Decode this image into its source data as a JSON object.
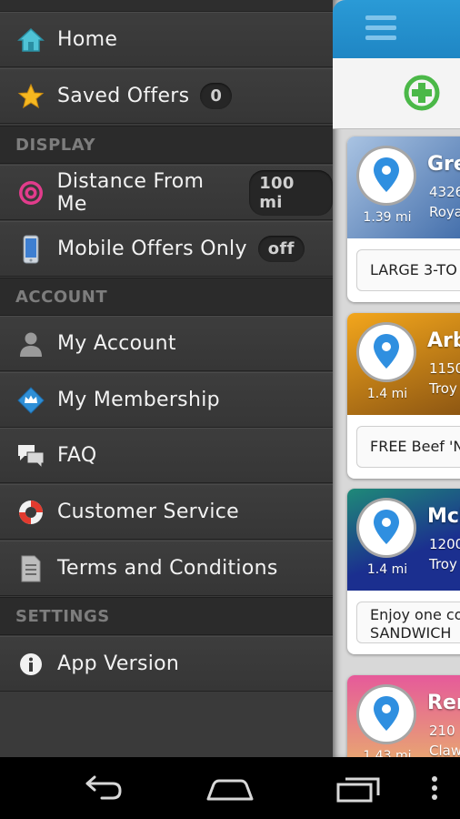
{
  "drawer": {
    "items_top": [
      {
        "label": "Home",
        "icon": "home-icon"
      },
      {
        "label": "Saved Offers",
        "icon": "star-icon",
        "badge": "0"
      }
    ],
    "display_header": "DISPLAY",
    "display_items": [
      {
        "label": "Distance From Me",
        "icon": "target-icon",
        "badge": "100 mi"
      },
      {
        "label": "Mobile Offers Only",
        "icon": "phone-icon",
        "badge": "off"
      }
    ],
    "account_header": "ACCOUNT",
    "account_items": [
      {
        "label": "My Account",
        "icon": "person-icon"
      },
      {
        "label": "My Membership",
        "icon": "crown-diamond-icon"
      },
      {
        "label": "FAQ",
        "icon": "chat-bubbles-icon"
      },
      {
        "label": "Customer Service",
        "icon": "life-ring-icon"
      },
      {
        "label": "Terms and Conditions",
        "icon": "document-icon"
      }
    ],
    "settings_header": "SETTINGS",
    "settings_items": [
      {
        "label": "App Version",
        "icon": "info-icon"
      }
    ]
  },
  "main": {
    "cards": [
      {
        "name": "Gre",
        "distance": "1.39 mi",
        "addr1": "4326",
        "addr2": "Roya",
        "offer": "LARGE 3-TO",
        "color_top": "#9fb9d8",
        "color_bottom": "#3e6aa8"
      },
      {
        "name": "Arb",
        "distance": "1.4 mi",
        "addr1": "1150",
        "addr2": "Troy",
        "offer": "FREE Beef 'N",
        "color_top": "#f0a21a",
        "color_bottom": "#7a4a10"
      },
      {
        "name": "Mcl",
        "distance": "1.4 mi",
        "addr1": "1200",
        "addr2": "Troy",
        "offer_line1": "Enjoy one co",
        "offer_line2": "SANDWICH",
        "color_top": "#1f8a78",
        "color_bottom": "#1b2f8f"
      },
      {
        "name": "Ren",
        "distance": "1.43 mi",
        "addr1": "210",
        "addr2": "Claw",
        "color_top": "#e65a9a",
        "color_bottom": "#e0b46a"
      }
    ]
  },
  "colors": {
    "drawer_bg": "#3a3a3a",
    "header_bg": "#2b2b2b",
    "appbar_blue": "#2a9ad6",
    "add_green": "#4bb848"
  }
}
